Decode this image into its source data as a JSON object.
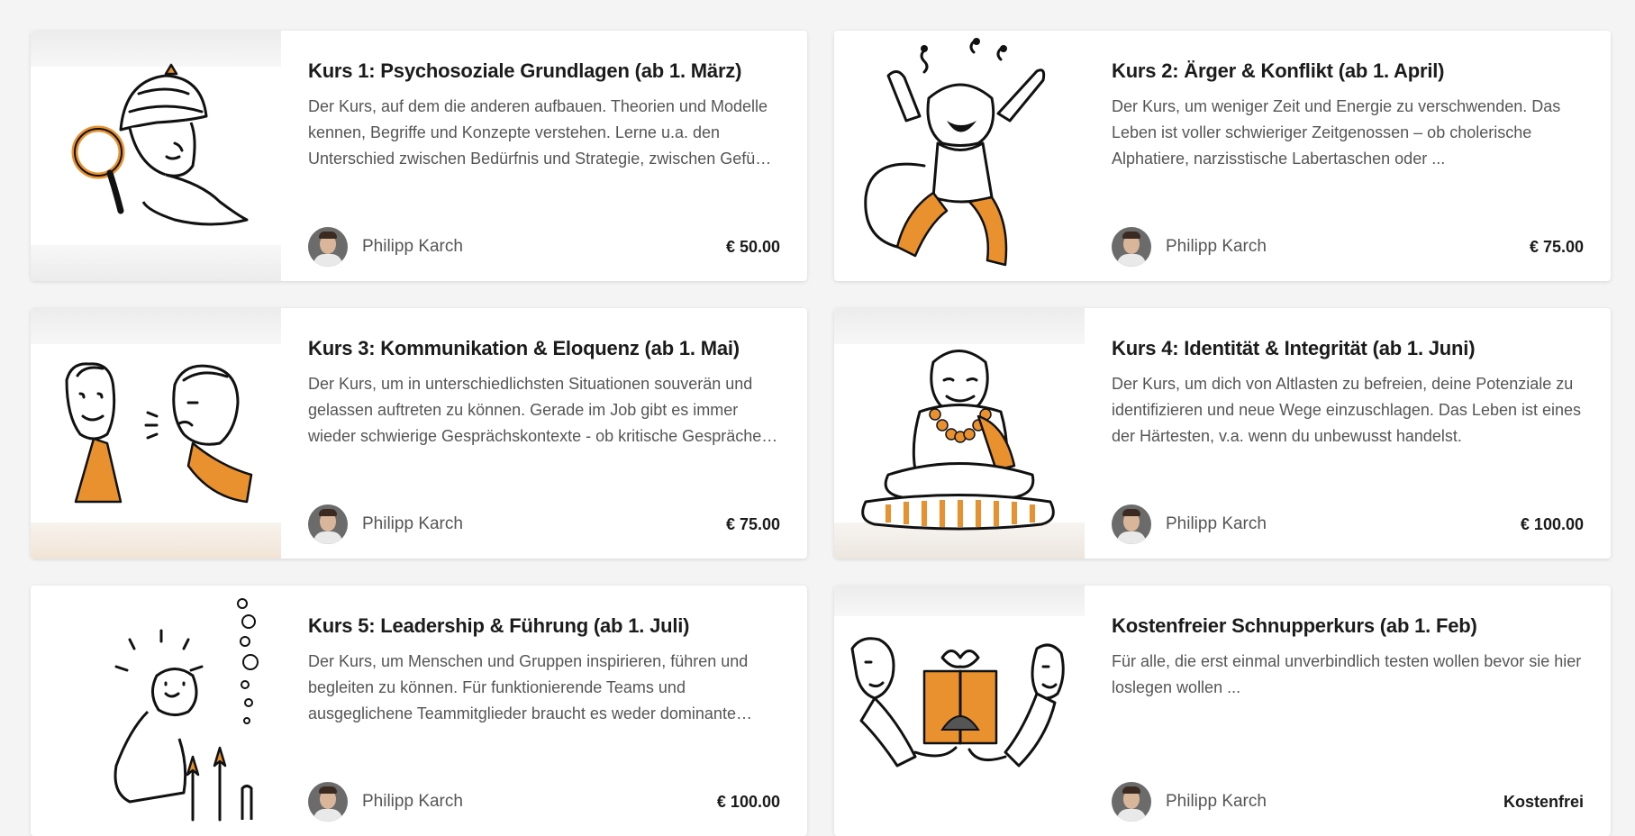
{
  "courses": [
    {
      "title": "Kurs 1: Psychosoziale Grundlagen (ab 1. März)",
      "description": "Der Kurs, auf dem die anderen aufbauen. Theorien und Modelle kennen, Begriffe und Konzepte verstehen. Lerne u.a. den Unterschied zwischen Bedürfnis und Strategie, zwischen Gefühl und Gedanke kennen.",
      "author": "Philipp Karch",
      "price": "€ 50.00",
      "illustration": "detective-magnifier-icon"
    },
    {
      "title": "Kurs 2: Ärger & Konflikt (ab 1. April)",
      "description": "Der Kurs, um weniger Zeit und Energie zu verschwenden. Das Leben ist voller schwieriger Zeitgenossen – ob cholerische Alphatiere, narzisstische Labertaschen oder ...",
      "author": "Philipp Karch",
      "price": "€ 75.00",
      "illustration": "angry-monkey-icon"
    },
    {
      "title": "Kurs 3: Kommunikation & Eloquenz (ab 1. Mai)",
      "description": "Der Kurs, um in unterschiedlichsten Situationen souverän und gelassen auftreten zu können. Gerade im Job gibt es immer wieder schwierige Gesprächskontexte - ob kritische Gespräche oder Verhandlungen.",
      "author": "Philipp Karch",
      "price": "€ 75.00",
      "illustration": "two-faces-talking-icon"
    },
    {
      "title": "Kurs 4: Identität & Integrität (ab 1. Juni)",
      "description": "Der Kurs, um dich von Altlasten zu befreien, deine Potenziale zu identifizieren und neue Wege einzuschlagen. Das Leben ist eines der Härtesten, v.a. wenn du unbewusst handelst.",
      "author": "Philipp Karch",
      "price": "€ 100.00",
      "illustration": "meditating-buddha-icon"
    },
    {
      "title": "Kurs 5: Leadership & Führung (ab 1. Juli)",
      "description": "Der Kurs, um Menschen und Gruppen inspirieren, führen und begleiten zu können. Für funktionierende Teams und ausgeglichene Teammitglieder braucht es weder dominante Chefs noch Kontrolle.",
      "author": "Philipp Karch",
      "price": "€ 100.00",
      "illustration": "rocket-launcher-icon"
    },
    {
      "title": "Kostenfreier Schnupperkurs (ab 1. Feb)",
      "description": "Für alle, die erst einmal unverbindlich testen wollen bevor sie hier loslegen wollen ...",
      "author": "Philipp Karch",
      "price": "Kostenfrei",
      "illustration": "gift-exchange-icon"
    }
  ]
}
